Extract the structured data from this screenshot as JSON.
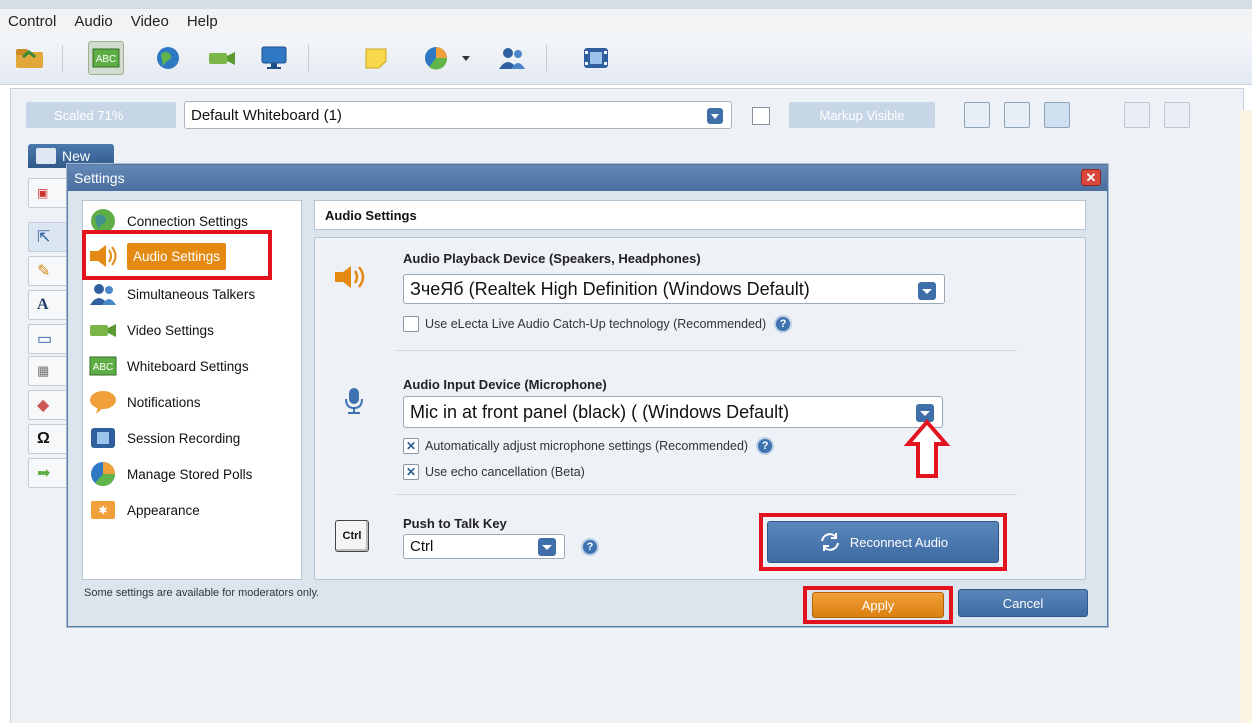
{
  "menu": [
    "Control",
    "Audio",
    "Video",
    "Help"
  ],
  "whiteboard": {
    "scale_label": "Scaled 71%",
    "selected": "Default Whiteboard (1)",
    "markup_label": "Markup Visible",
    "new_tab_label": "New"
  },
  "dialog": {
    "title": "Settings",
    "close_glyph": "✕",
    "nav": [
      {
        "label": "Connection Settings",
        "icon": "globe-icon"
      },
      {
        "label": "Audio Settings",
        "icon": "speaker-icon"
      },
      {
        "label": "Simultaneous Talkers",
        "icon": "users-icon"
      },
      {
        "label": "Video Settings",
        "icon": "camera-icon"
      },
      {
        "label": "Whiteboard Settings",
        "icon": "abc-icon"
      },
      {
        "label": "Notifications",
        "icon": "speech-bubble-icon"
      },
      {
        "label": "Session Recording",
        "icon": "film-icon"
      },
      {
        "label": "Manage Stored Polls",
        "icon": "pie-chart-icon"
      },
      {
        "label": "Appearance",
        "icon": "palette-icon"
      }
    ],
    "selected_nav": "Audio Settings",
    "footnote": "Some settings are available for moderators only.",
    "panel_title": "Audio Settings",
    "playback": {
      "label": "Audio Playback Device (Speakers, Headphones)",
      "value": "ЗчеЯб (Realtek High Definition  (Windows Default)",
      "catchup_label": "Use eLecta Live Audio Catch-Up technology (Recommended)",
      "catchup_checked": false
    },
    "input": {
      "label": "Audio Input Device (Microphone)",
      "value": "Mic in at front panel (black) ( (Windows Default)",
      "auto_adjust_label": "Automatically adjust microphone settings (Recommended)",
      "auto_adjust_checked": true,
      "echo_label": "Use echo cancellation (Beta)",
      "echo_checked": true
    },
    "ptt": {
      "label": "Push to Talk Key",
      "key_icon_text": "Ctrl",
      "value": "Ctrl"
    },
    "reconnect_label": "Reconnect Audio",
    "apply_label": "Apply",
    "cancel_label": "Cancel",
    "check_glyph": "✕",
    "help_glyph": "?"
  },
  "colors": {
    "accent_orange": "#e48a13",
    "accent_blue": "#3e6fa8",
    "highlight_red": "#e3121f"
  }
}
